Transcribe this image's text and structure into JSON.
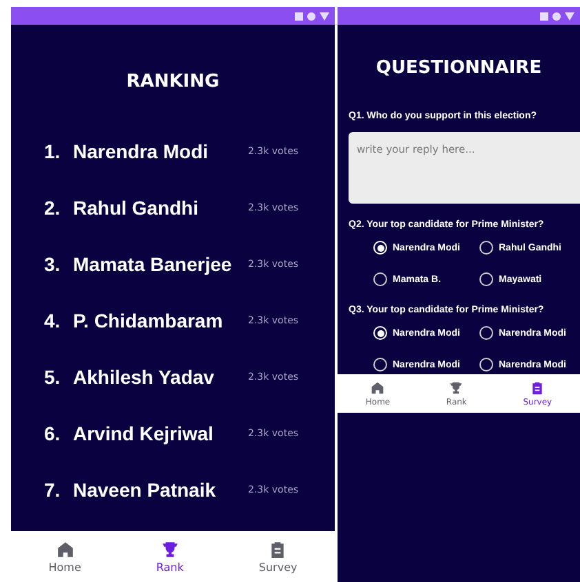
{
  "ranking_screen": {
    "title": "RANKING",
    "items": [
      {
        "rank": "1.",
        "name": "Narendra Modi",
        "votes": "2.3k votes"
      },
      {
        "rank": "2.",
        "name": "Rahul Gandhi",
        "votes": "2.3k votes"
      },
      {
        "rank": "3.",
        "name": "Mamata Banerjee",
        "votes": "2.3k votes"
      },
      {
        "rank": "4.",
        "name": "P. Chidambaram",
        "votes": "2.3k votes"
      },
      {
        "rank": "5.",
        "name": "Akhilesh Yadav",
        "votes": "2.3k votes"
      },
      {
        "rank": "6.",
        "name": "Arvind Kejriwal",
        "votes": "2.3k votes"
      },
      {
        "rank": "7.",
        "name": "Naveen Patnaik",
        "votes": "2.3k votes"
      }
    ],
    "nav": [
      {
        "kind": "home",
        "label": "Home",
        "selected": false
      },
      {
        "kind": "rank",
        "label": "Rank",
        "selected": true
      },
      {
        "kind": "survey",
        "label": "Survey",
        "selected": false
      }
    ]
  },
  "questionnaire_screen": {
    "title": "QUESTIONNAIRE",
    "questions": [
      {
        "kind": "text",
        "label": "Q1. Who do you support in this election?",
        "placeholder": "write your reply here..."
      },
      {
        "kind": "radio",
        "label": "Q2. Your top candidate for Prime Minister?",
        "options": [
          {
            "label": "Narendra Modi",
            "selected": true
          },
          {
            "label": "Rahul Gandhi",
            "selected": false
          },
          {
            "label": "Mamata B.",
            "selected": false
          },
          {
            "label": "Mayawati",
            "selected": false
          }
        ]
      },
      {
        "kind": "radio",
        "label": "Q3. Your top candidate for Prime Minister?",
        "options": [
          {
            "label": "Narendra Modi",
            "selected": true
          },
          {
            "label": "Narendra Modi",
            "selected": false
          },
          {
            "label": "Narendra Modi",
            "selected": false
          },
          {
            "label": "Narendra Modi",
            "selected": false
          }
        ]
      }
    ],
    "nav": [
      {
        "kind": "home",
        "label": "Home",
        "selected": false
      },
      {
        "kind": "rank",
        "label": "Rank",
        "selected": false
      },
      {
        "kind": "survey",
        "label": "Survey",
        "selected": true
      }
    ]
  }
}
